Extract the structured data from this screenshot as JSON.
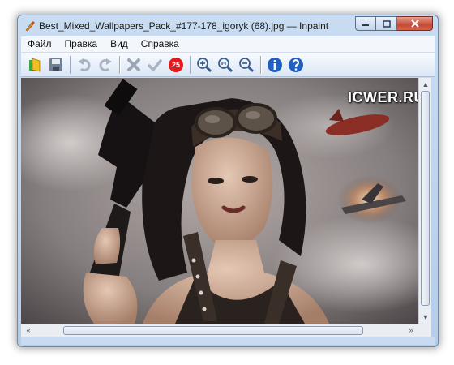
{
  "window": {
    "title": "Best_Mixed_Wallpapers_Pack_#177-178_igoryk (68).jpg — Inpaint"
  },
  "menu": {
    "items": [
      {
        "label": "Файл"
      },
      {
        "label": "Правка"
      },
      {
        "label": "Вид"
      },
      {
        "label": "Справка"
      }
    ]
  },
  "toolbar": {
    "open_icon": "open-image-icon",
    "save_icon": "save-disk-icon",
    "undo_icon": "undo-arrow-icon",
    "redo_icon": "redo-arrow-icon",
    "erase_icon": "erase-x-icon",
    "apply_icon": "apply-check-icon",
    "badge_value": "25",
    "zoom_in_icon": "zoom-in-icon",
    "zoom_actual_icon": "zoom-actual-size-icon",
    "zoom_out_icon": "zoom-out-icon",
    "info_icon": "info-icon",
    "help_icon": "help-icon"
  },
  "image": {
    "watermark": "ICWER.RU",
    "description_icon": "photo-woman-with-gun"
  },
  "colors": {
    "badge": "#e61818",
    "info": "#1f5fc2",
    "window_frame": "#b6cde8"
  }
}
